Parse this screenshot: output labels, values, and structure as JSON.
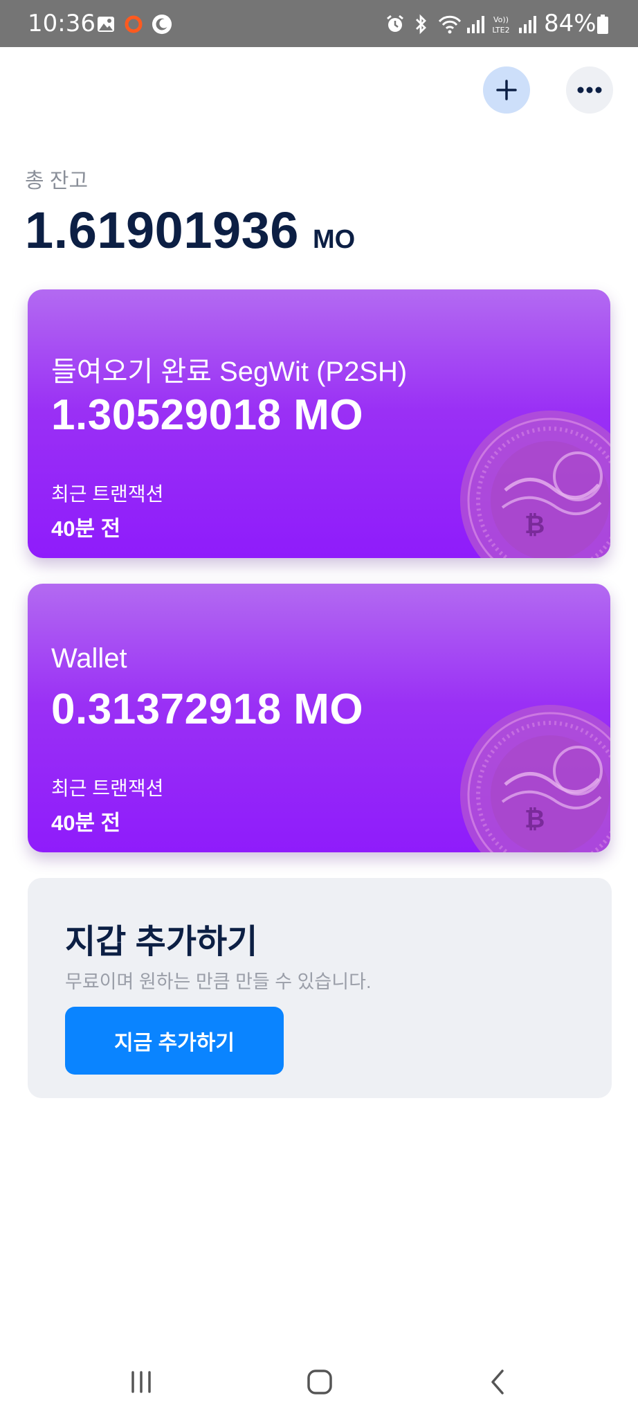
{
  "status_bar": {
    "time": "10:36",
    "battery": "84%",
    "icons": [
      "gallery-icon",
      "record-icon",
      "night-mode-icon",
      "alarm-icon",
      "bluetooth-icon",
      "wifi-icon",
      "signal-icon",
      "volte-lte2-icon",
      "signal-icon",
      "battery-icon"
    ]
  },
  "header": {
    "add_icon": "plus-icon",
    "more_icon": "more-horizontal-icon"
  },
  "balance": {
    "label": "총 잔고",
    "value": "1.61901936",
    "unit": "MO"
  },
  "wallets": [
    {
      "name": "들여오기 완료 SegWit (P2SH)",
      "amount": "1.30529018 MO",
      "tx_label": "최근 트랜잭션",
      "tx_time": "40분 전"
    },
    {
      "name": "Wallet",
      "amount": "0.31372918 MO",
      "tx_label": "최근 트랜잭션",
      "tx_time": "40분 전"
    }
  ],
  "add_wallet": {
    "title": "지갑 추가하기",
    "description": "무료이며 원하는 만큼 만들 수 있습니다.",
    "button": "지금 추가하기"
  },
  "nav": [
    "recent-apps-icon",
    "home-icon",
    "back-icon"
  ],
  "colors": {
    "status_bar": "#757575",
    "card_top": "#b36af1",
    "card_bottom": "#8f1cfb",
    "primary_button": "#0a84ff",
    "text_dark": "#0c1f44",
    "add_panel_bg": "#eef0f4"
  }
}
